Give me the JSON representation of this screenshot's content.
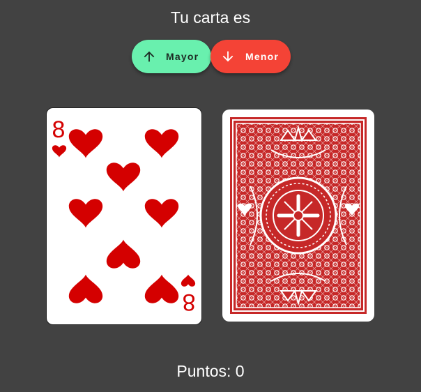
{
  "header": {
    "title": "Tu carta es"
  },
  "buttons": {
    "higher": {
      "label": "Mayor",
      "icon": "arrow-up-icon",
      "color": "#69f0ae"
    },
    "lower": {
      "label": "Menor",
      "icon": "arrow-down-icon",
      "color": "#f44336"
    }
  },
  "current_card": {
    "rank": "8",
    "suit": "hearts",
    "color": "#d40000"
  },
  "next_card": {
    "face": "down",
    "back_color": "#c62828"
  },
  "score": {
    "text": "Puntos: 0"
  }
}
